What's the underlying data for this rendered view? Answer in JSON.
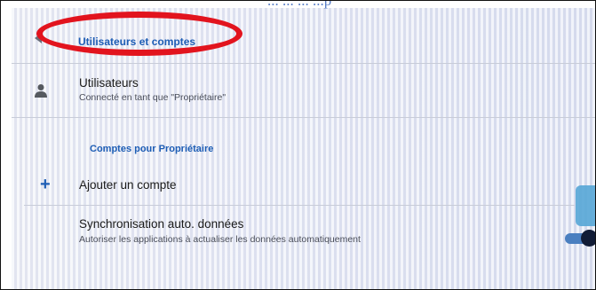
{
  "caption": "... ... ... ...p",
  "header": {
    "title": "Utilisateurs et comptes",
    "back_icon": "arrow-back-icon"
  },
  "users_item": {
    "icon": "person-icon",
    "title": "Utilisateurs",
    "subtitle": "Connecté en tant que \"Propriétaire\""
  },
  "accounts_section": {
    "label": "Comptes pour Propriétaire"
  },
  "add_account": {
    "icon": "plus-icon",
    "label": "Ajouter un compte"
  },
  "sync": {
    "title": "Synchronisation auto. données",
    "subtitle": "Autoriser les applications à actualiser les données automatiquement",
    "enabled": true
  },
  "colors": {
    "accent": "#1d5db5",
    "annotation": "#e2141e",
    "toggle_thumb": "#111c36"
  }
}
